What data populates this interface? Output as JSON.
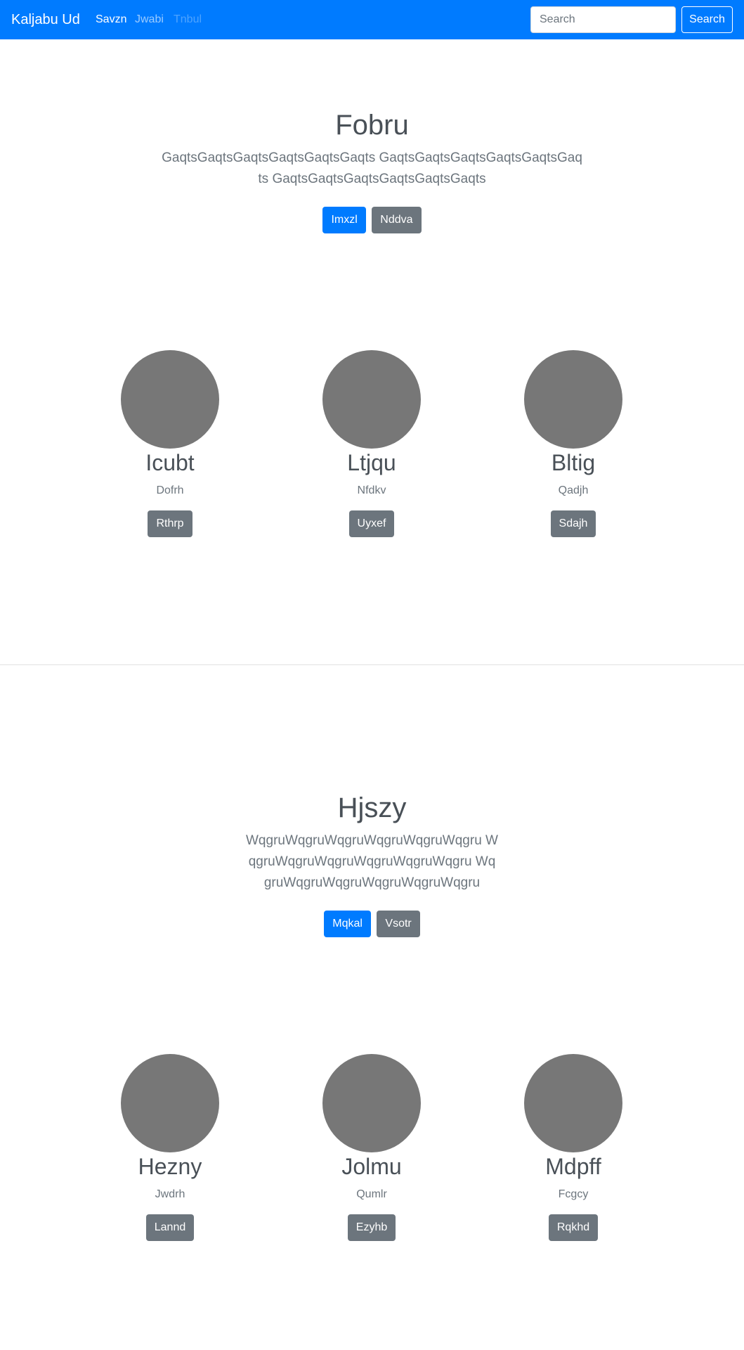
{
  "navbar": {
    "brand": "Kaljabu Ud",
    "links": [
      {
        "label": "Savzn",
        "state": "active"
      },
      {
        "label": "Jwabi",
        "state": "normal"
      },
      {
        "label": "Tnbul",
        "state": "disabled"
      }
    ],
    "search_placeholder": "Search",
    "search_button": "Search"
  },
  "sections": [
    {
      "title": "Fobru",
      "lead": "GaqtsGaqtsGaqtsGaqtsGaqtsGaqts GaqtsGaqtsGaqtsGaqtsGaqtsGaqts GaqtsGaqtsGaqtsGaqtsGaqtsGaqts",
      "primary_button": "Imxzl",
      "secondary_button": "Nddva",
      "profiles": [
        {
          "name": "Icubt",
          "subtitle": "Dofrh",
          "button": "Rthrp"
        },
        {
          "name": "Ltjqu",
          "subtitle": "Nfdkv",
          "button": "Uyxef"
        },
        {
          "name": "Bltig",
          "subtitle": "Qadjh",
          "button": "Sdajh"
        }
      ]
    },
    {
      "title": "Hjszy",
      "lead": "WqgruWqgruWqgruWqgruWqgruWqgru WqgruWqgruWqgruWqgruWqgruWqgru WqgruWqgruWqgruWqgruWqgruWqgru",
      "primary_button": "Mqkal",
      "secondary_button": "Vsotr",
      "profiles": [
        {
          "name": "Hezny",
          "subtitle": "Jwdrh",
          "button": "Lannd"
        },
        {
          "name": "Jolmu",
          "subtitle": "Qumlr",
          "button": "Ezyhb"
        },
        {
          "name": "Mdpff",
          "subtitle": "Fcgcy",
          "button": "Rqkhd"
        }
      ]
    }
  ],
  "colors": {
    "primary": "#007bff",
    "secondary": "#6c757d",
    "avatar": "#777777"
  }
}
